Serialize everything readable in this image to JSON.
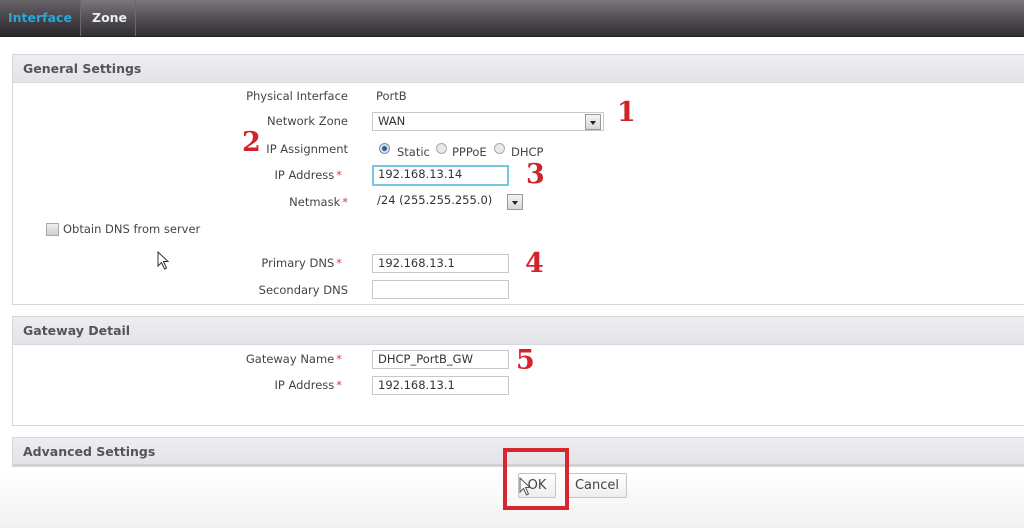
{
  "tabs": [
    {
      "label": "Interface",
      "active": true
    },
    {
      "label": "Zone",
      "active": false
    }
  ],
  "general_settings": {
    "title": "General Settings",
    "physical_interface": {
      "label": "Physical Interface",
      "value": "PortB"
    },
    "network_zone": {
      "label": "Network Zone",
      "value": "WAN"
    },
    "ip_assignment": {
      "label": "IP Assignment",
      "options": [
        "Static",
        "PPPoE",
        "DHCP"
      ],
      "selected": "Static"
    },
    "ip_address": {
      "label": "IP Address",
      "value": "192.168.13.14",
      "required": true
    },
    "netmask": {
      "label": "Netmask",
      "value": "/24 (255.255.255.0)",
      "required": true
    },
    "obtain_dns": {
      "label": "Obtain DNS from server",
      "checked": false
    },
    "primary_dns": {
      "label": "Primary DNS",
      "value": "192.168.13.1",
      "required": true
    },
    "secondary_dns": {
      "label": "Secondary DNS",
      "value": ""
    }
  },
  "gateway_detail": {
    "title": "Gateway Detail",
    "gateway_name": {
      "label": "Gateway Name",
      "value": "DHCP_PortB_GW",
      "required": true
    },
    "ip_address": {
      "label": "IP Address",
      "value": "192.168.13.1",
      "required": true
    }
  },
  "advanced_settings": {
    "title": "Advanced Settings"
  },
  "buttons": {
    "ok": "OK",
    "cancel": "Cancel"
  },
  "annotations": [
    "1",
    "2",
    "3",
    "4",
    "5"
  ],
  "required_marker": "*",
  "colors": {
    "active_tab": "#2ba6d9",
    "annotation": "#d1232a",
    "required": "#e0393e",
    "focus_border": "#76c6e4"
  }
}
